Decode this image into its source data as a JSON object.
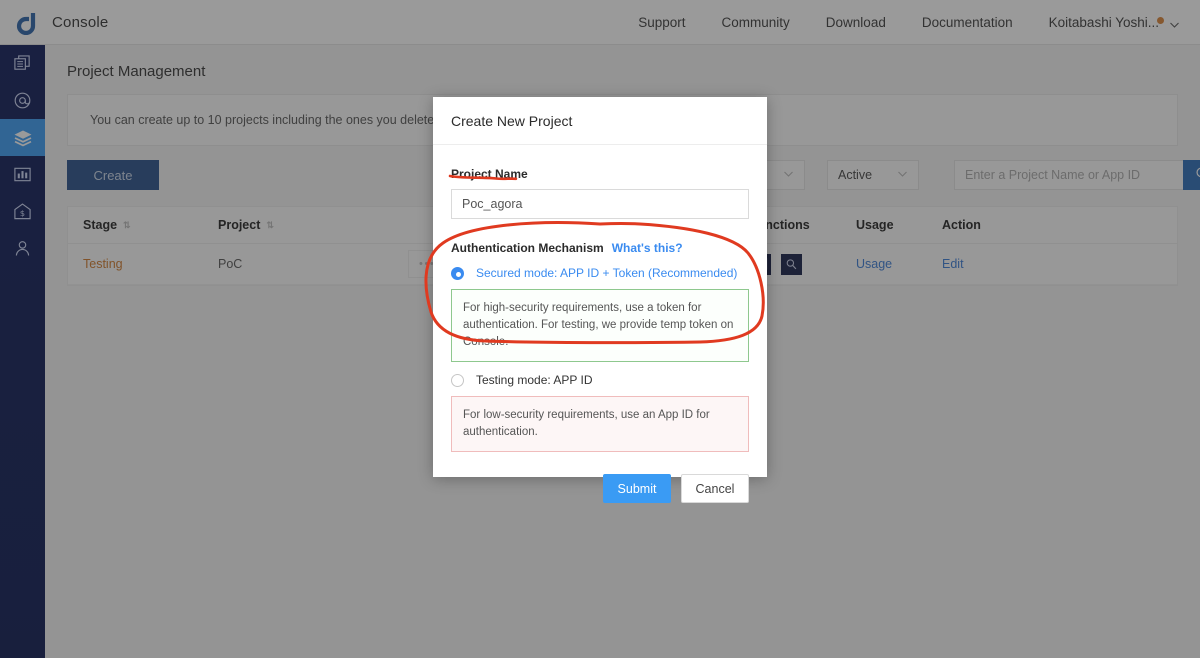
{
  "topbar": {
    "brand": "Console",
    "logo_icon": "agora-logo-icon",
    "nav": [
      {
        "label": "Support"
      },
      {
        "label": "Community"
      },
      {
        "label": "Download"
      },
      {
        "label": "Documentation"
      }
    ],
    "user": {
      "name": "Koitabashi Yoshi...",
      "caret_icon": "chevron-down-icon",
      "notification_dot_color": "#d98236"
    }
  },
  "sidebar": {
    "items": [
      {
        "name": "projects",
        "icon": "copy-stack-icon",
        "active": false
      },
      {
        "name": "at",
        "icon": "at-sign-icon",
        "active": false
      },
      {
        "name": "layers",
        "icon": "layers-icon",
        "active": true
      },
      {
        "name": "analytics",
        "icon": "bar-chart-icon",
        "active": false
      },
      {
        "name": "billing",
        "icon": "house-dollar-icon",
        "active": false
      },
      {
        "name": "members",
        "icon": "user-icon",
        "active": false
      }
    ]
  },
  "main": {
    "page_title": "Project Management",
    "notice": "You can create up to 10 projects including the ones you deleted. If you need mo",
    "create_button": "Create",
    "filters": {
      "stage": {
        "value": "",
        "caret_icon": "chevron-down-icon"
      },
      "status": {
        "value": "Active",
        "caret_icon": "chevron-down-icon"
      }
    },
    "search": {
      "placeholder": "Enter a Project Name or App ID",
      "value": "",
      "button_icon": "search-icon",
      "button_color": "#2b6cb8"
    },
    "table": {
      "headers": [
        {
          "label": "Stage",
          "sortable": true
        },
        {
          "label": "Project",
          "sortable": true
        },
        {
          "label": "",
          "sortable": false
        },
        {
          "label": "Functions",
          "sortable": false
        },
        {
          "label": "Usage",
          "sortable": false
        },
        {
          "label": "Action",
          "sortable": false
        }
      ],
      "rows": [
        {
          "stage": "Testing",
          "stage_color": "#d07a2c",
          "project": "PoC",
          "appid_masked": "••••••••••••••••••••••",
          "appid_eye_icon": "eye-closed-icon",
          "functions": [
            {
              "icon": "document-list-icon"
            },
            {
              "icon": "magnifier-icon"
            }
          ],
          "usage_link": "Usage",
          "action_link": "Edit"
        }
      ]
    }
  },
  "modal": {
    "title": "Create New Project",
    "project_name": {
      "label": "Project Name",
      "value": "Poc_agora"
    },
    "auth": {
      "heading": "Authentication Mechanism",
      "help_link": "What's this?",
      "options": [
        {
          "id": "secured",
          "label": "Secured mode: APP ID + Token (Recommended)",
          "selected": true,
          "hint": "For high-security requirements, use a token for authentication. For testing, we provide temp token on Console.",
          "hint_border": "#8ec88e"
        },
        {
          "id": "testing",
          "label": "Testing mode: APP ID",
          "selected": false,
          "hint": "For low-security requirements, use an App ID for authentication.",
          "hint_border": "#f0bcbc"
        }
      ]
    },
    "submit_button": "Submit",
    "cancel_button": "Cancel"
  },
  "annotations": {
    "color": "#e03a20",
    "marks": [
      {
        "type": "underline",
        "target": "project-name-label"
      },
      {
        "type": "ellipse",
        "target": "secured-mode-option-group"
      }
    ]
  }
}
